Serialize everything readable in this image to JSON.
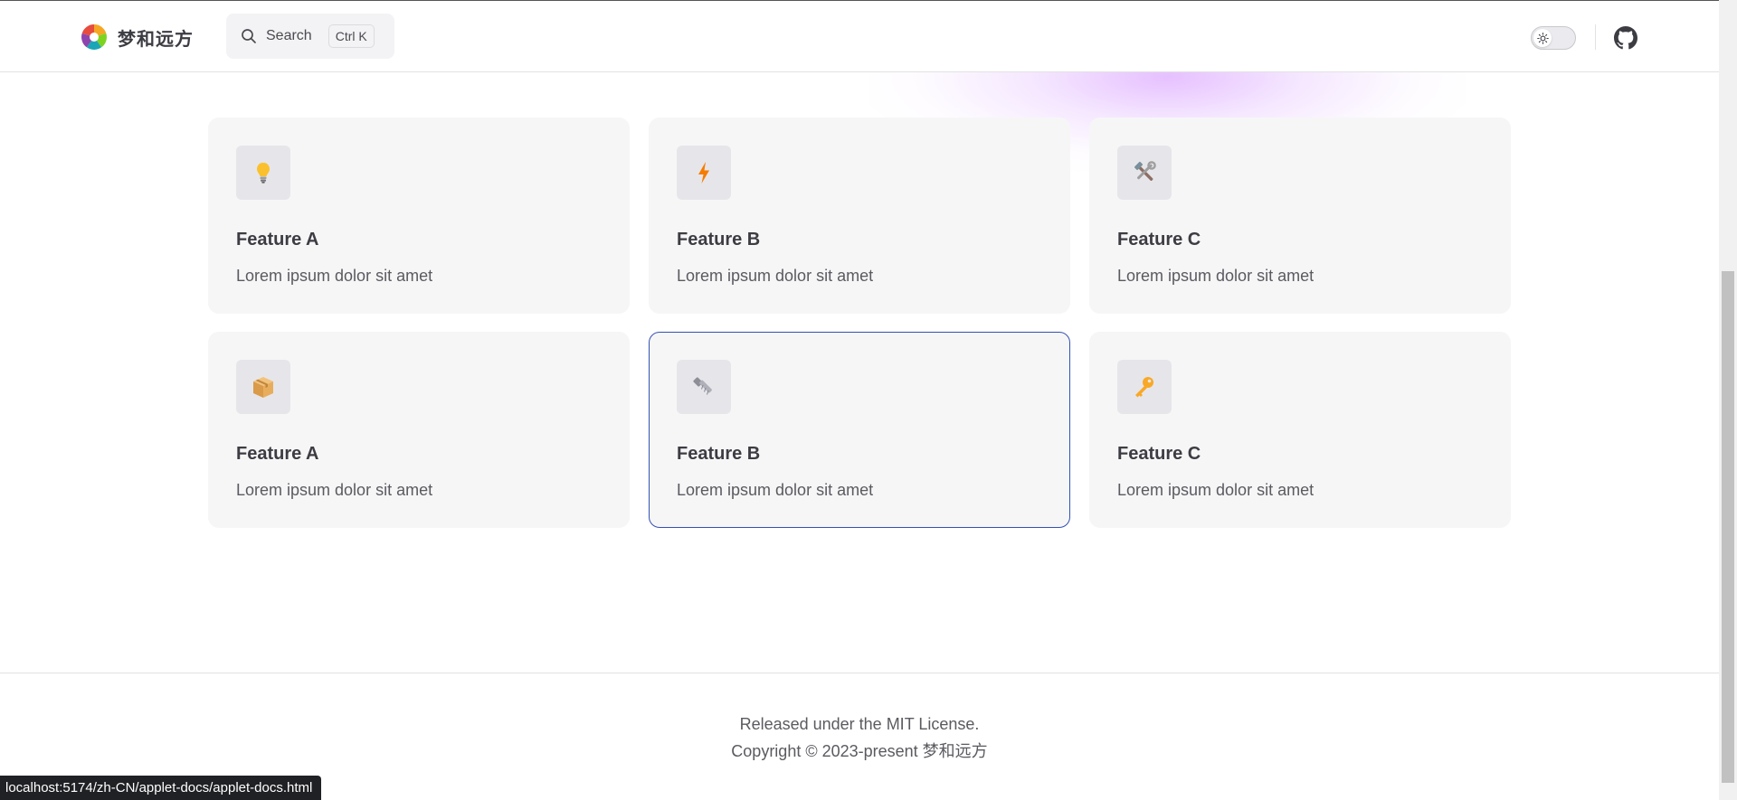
{
  "header": {
    "brand_name": "梦和远方",
    "search": {
      "label": "Search",
      "shortcut": "Ctrl K"
    },
    "theme_toggle": {
      "state": "light"
    }
  },
  "features": [
    {
      "icon": "lightbulb-icon",
      "title": "Feature A",
      "details": "Lorem ipsum dolor sit amet"
    },
    {
      "icon": "lightning-icon",
      "title": "Feature B",
      "details": "Lorem ipsum dolor sit amet"
    },
    {
      "icon": "hammer-wrench-icon",
      "title": "Feature C",
      "details": "Lorem ipsum dolor sit amet"
    },
    {
      "icon": "package-icon",
      "title": "Feature A",
      "details": "Lorem ipsum dolor sit amet"
    },
    {
      "icon": "bolt-screw-icon",
      "title": "Feature B",
      "details": "Lorem ipsum dolor sit amet",
      "active": true
    },
    {
      "icon": "key-icon",
      "title": "Feature C",
      "details": "Lorem ipsum dolor sit amet"
    }
  ],
  "footer": {
    "message": "Released under the MIT License.",
    "copyright": "Copyright © 2023-present 梦和远方"
  },
  "status_bar": {
    "url": "localhost:5174/zh-CN/applet-docs/applet-docs.html"
  },
  "colors": {
    "accent": "#3451b2",
    "card_bg": "#f6f6f7",
    "text": "#3c3c43",
    "glow": "#d68bff"
  }
}
